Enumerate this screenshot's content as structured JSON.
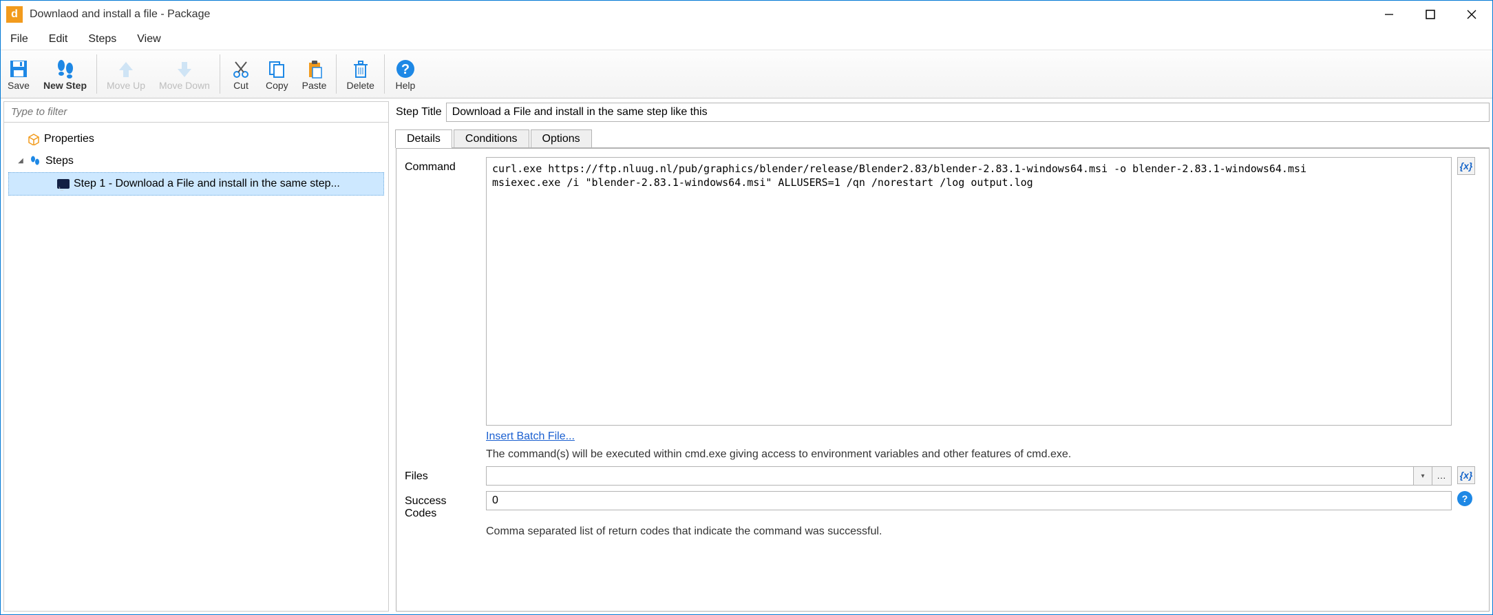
{
  "window": {
    "title": "Downlaod and install a file - Package"
  },
  "menu": {
    "file": "File",
    "edit": "Edit",
    "steps": "Steps",
    "view": "View"
  },
  "toolbar": {
    "save": "Save",
    "newstep": "New Step",
    "moveup": "Move Up",
    "movedown": "Move Down",
    "cut": "Cut",
    "copy": "Copy",
    "paste": "Paste",
    "delete": "Delete",
    "help": "Help"
  },
  "leftpanel": {
    "filter_placeholder": "Type to filter",
    "properties_label": "Properties",
    "steps_label": "Steps",
    "step1_label": "Step 1 - Download a File and install in the same step..."
  },
  "rightpanel": {
    "steptitle_label": "Step Title",
    "steptitle_value": "Download a File and install in the same step like this",
    "tabs": {
      "details": "Details",
      "conditions": "Conditions",
      "options": "Options"
    },
    "command_label": "Command",
    "command_value": "curl.exe https://ftp.nluug.nl/pub/graphics/blender/release/Blender2.83/blender-2.83.1-windows64.msi -o blender-2.83.1-windows64.msi\nmsiexec.exe /i \"blender-2.83.1-windows64.msi\" ALLUSERS=1 /qn /norestart /log output.log",
    "insert_batch": "Insert Batch File...",
    "command_help": "The command(s) will be executed within cmd.exe giving access to environment variables and other features of cmd.exe.",
    "files_label": "Files",
    "files_value": "",
    "success_label": "Success Codes",
    "success_value": "0",
    "success_help": "Comma separated list of return codes that indicate the command was successful.",
    "var_glyph": "{x}",
    "browse_glyph": "..."
  }
}
